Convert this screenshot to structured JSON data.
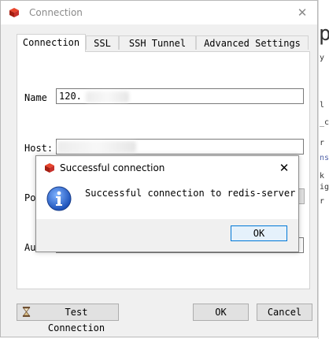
{
  "window": {
    "title": "Connection",
    "close_glyph": "✕"
  },
  "tabs": [
    "Connection",
    "SSL",
    "SSH Tunnel",
    "Advanced Settings"
  ],
  "form": {
    "name_label": "Name",
    "name_value": "120.",
    "host_label": "Host:",
    "port_label_partial": "Po",
    "auth_label_partial": "Au"
  },
  "buttons": {
    "test": "Test Connection",
    "ok": "OK",
    "cancel": "Cancel"
  },
  "popup": {
    "title": "Successful connection",
    "message": "Successful connection to redis-server",
    "ok": "OK",
    "close_glyph": "✕"
  },
  "background": {
    "glyphs": [
      "p",
      "y",
      "l",
      "_c",
      "r",
      "ns",
      "k",
      "ig",
      "r"
    ]
  },
  "colors": {
    "redis_red": "#d82c20",
    "info_blue": "#1c5fcf",
    "focus_blue": "#0078d7"
  }
}
